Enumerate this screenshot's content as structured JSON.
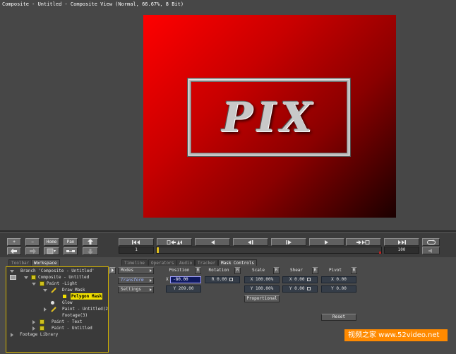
{
  "viewer": {
    "title": "Composite - Untitled - Composite View (Normal, 66.67%, 8 Bit)",
    "logo_text": "PIX"
  },
  "controls": {
    "plus": "+",
    "minus": "−",
    "home": "Home",
    "pan": "Pan",
    "current_frame": "1",
    "end_frame": "100",
    "timeline_progress": 0.0
  },
  "tabs": [
    {
      "label": "Toolbar",
      "active": false
    },
    {
      "label": "Workspace",
      "active": true
    },
    {
      "label": "Timeline",
      "active": false
    },
    {
      "label": "Operators",
      "active": false
    },
    {
      "label": "Audio",
      "active": false
    },
    {
      "label": "Tracker",
      "active": false
    },
    {
      "label": "Mask Controls",
      "active": true
    }
  ],
  "tree": [
    {
      "label": "Branch 'Composite - Untitled'",
      "icon": "branch-icon"
    },
    {
      "label": "Composite - Untitled",
      "icon": "composite-icon"
    },
    {
      "label": "Paint -Light",
      "icon": "paint-icon"
    },
    {
      "label": "Draw Mask",
      "icon": "mask-icon"
    },
    {
      "label": "Polygon Mask",
      "icon": "polygon-icon"
    },
    {
      "label": "Glow",
      "icon": "glow-icon"
    },
    {
      "label": "Paint - Untitled(2)",
      "icon": "paint-icon"
    },
    {
      "label": "Footage(3)",
      "icon": "footage-icon"
    },
    {
      "label": "Paint - Text",
      "icon": "paint-icon"
    },
    {
      "label": "Paint - Untitled",
      "icon": "paint-icon"
    },
    {
      "label": "Footage Library",
      "icon": "library-icon"
    }
  ],
  "mask": {
    "side_buttons": [
      "Modes",
      "Transform",
      "Settings"
    ],
    "columns": {
      "position": "Position",
      "rotation": "Rotation",
      "scale": "Scale",
      "shear": "Shear",
      "pivot": "Pivot",
      "r": "R"
    },
    "position_x": "-80.00",
    "position_y": "Y 209.00",
    "rotation": "R 0.00",
    "scale_x": "X 100.00%",
    "scale_y": "Y 100.00%",
    "shear_x": "X 0.00",
    "shear_y": "Y 0.00",
    "pivot_x": "X 0.00",
    "pivot_y": "Y 0.00",
    "x_label": "X",
    "proportional": "Proportional",
    "reset": "Reset"
  },
  "watermark": "视频之家 www.52video.net",
  "colors": {
    "canvas_red": "#ff0000",
    "selection_yellow": "#f0e000",
    "tree_border": "#d0b000",
    "watermark_orange": "#ff8a00"
  }
}
